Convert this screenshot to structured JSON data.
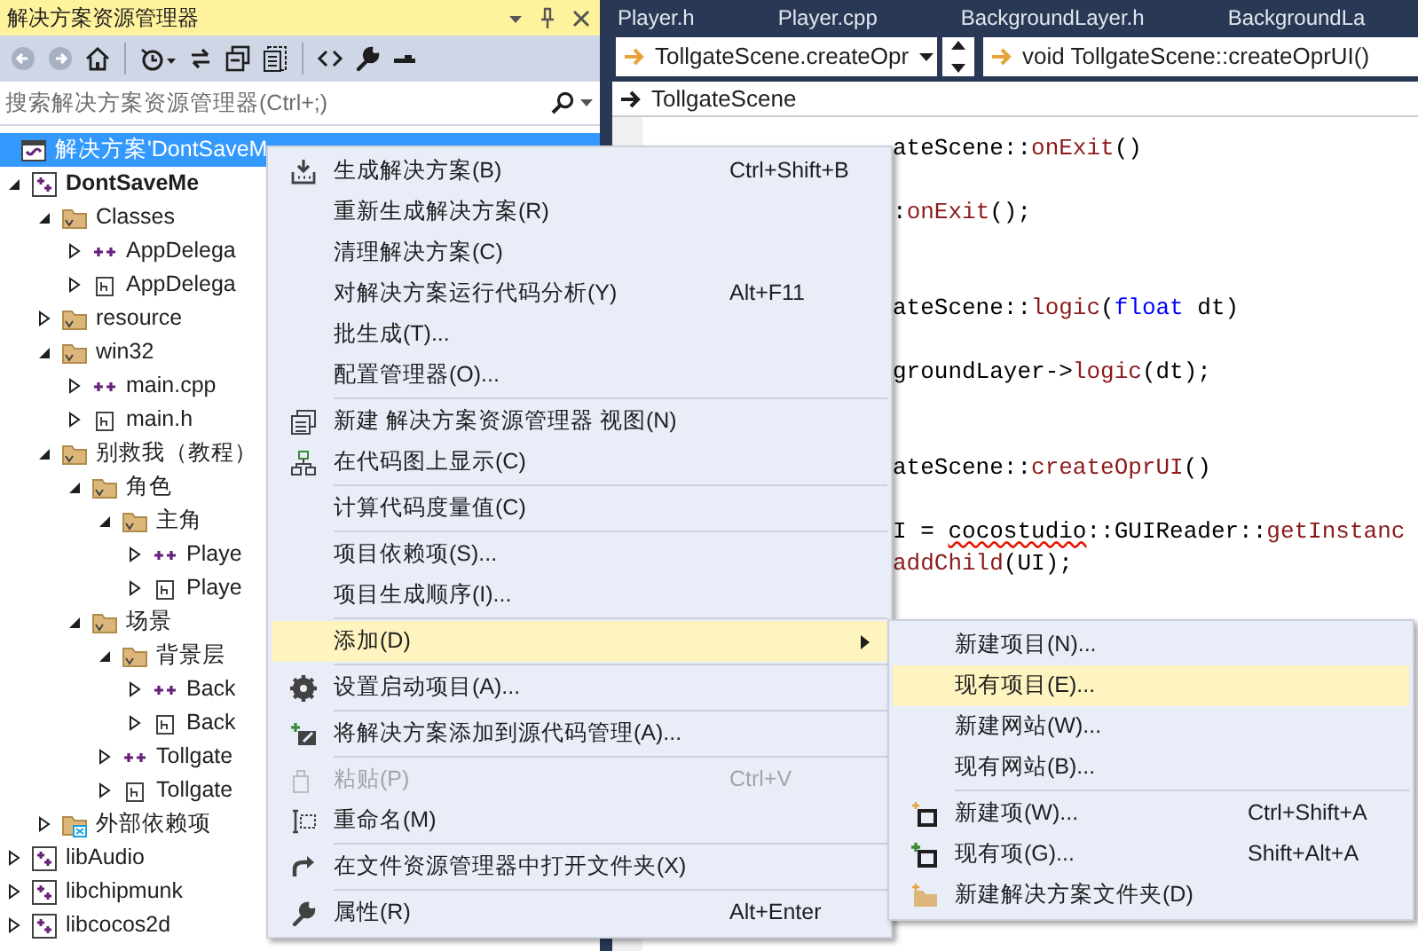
{
  "explorer": {
    "title": "解决方案资源管理器",
    "toolbar": [
      [
        {
          "kind": "back",
          "disabled": true
        },
        {
          "kind": "forward",
          "disabled": true
        },
        {
          "kind": "home",
          "disabled": false
        }
      ],
      [
        {
          "kind": "history",
          "disabled": false
        },
        {
          "kind": "sync",
          "disabled": false
        },
        {
          "kind": "collapse",
          "disabled": false
        },
        {
          "kind": "show_all",
          "disabled": false
        }
      ],
      [
        {
          "kind": "code",
          "disabled": false
        },
        {
          "kind": "wrench",
          "disabled": false
        },
        {
          "kind": "pending",
          "disabled": false
        }
      ]
    ],
    "search": {
      "placeholder": "搜索解决方案资源管理器(Ctrl+;)"
    },
    "tree": [
      {
        "label": "解决方案'DontSaveM",
        "kind": "solution",
        "selected": true
      },
      {
        "label": "DontSaveMe",
        "kind": "project",
        "startup": true,
        "expanded": true,
        "selected": false,
        "children": [
          {
            "label": "Classes",
            "kind": "filter",
            "expanded": true,
            "selected": false,
            "children": [
              {
                "label": "AppDelega",
                "kind": "cpp",
                "expanded": false,
                "selected": false
              },
              {
                "label": "AppDelega",
                "kind": "header",
                "expanded": false,
                "selected": false
              }
            ]
          },
          {
            "label": "resource",
            "kind": "filter",
            "expanded": false,
            "selected": false
          },
          {
            "label": "win32",
            "kind": "filter",
            "expanded": true,
            "selected": false,
            "children": [
              {
                "label": "main.cpp",
                "kind": "cpp",
                "expanded": false,
                "selected": false
              },
              {
                "label": "main.h",
                "kind": "header",
                "expanded": false,
                "selected": false
              }
            ]
          },
          {
            "label": "别救我（教程）",
            "kind": "filter",
            "expanded": true,
            "selected": false,
            "children": [
              {
                "label": "角色",
                "kind": "filter",
                "expanded": true,
                "selected": false,
                "children": [
                  {
                    "label": "主角",
                    "kind": "filter",
                    "expanded": true,
                    "selected": false,
                    "children": [
                      {
                        "label": "Playe",
                        "kind": "cpp",
                        "expanded": false,
                        "selected": false
                      },
                      {
                        "label": "Playe",
                        "kind": "header",
                        "expanded": false,
                        "selected": false
                      }
                    ]
                  }
                ]
              },
              {
                "label": "场景",
                "kind": "filter",
                "expanded": true,
                "selected": false,
                "children": [
                  {
                    "label": "背景层",
                    "kind": "filter",
                    "expanded": true,
                    "selected": false,
                    "children": [
                      {
                        "label": "Back",
                        "kind": "cpp",
                        "expanded": false,
                        "selected": false
                      },
                      {
                        "label": "Back",
                        "kind": "header",
                        "expanded": false,
                        "selected": false
                      }
                    ]
                  },
                  {
                    "label": "Tollgate",
                    "kind": "cpp",
                    "expanded": false,
                    "selected": false
                  },
                  {
                    "label": "Tollgate",
                    "kind": "header",
                    "expanded": false,
                    "selected": false
                  }
                ]
              }
            ]
          },
          {
            "label": "外部依赖项",
            "kind": "external",
            "expanded": false,
            "selected": false
          }
        ]
      },
      {
        "label": "libAudio",
        "kind": "project",
        "expanded": false,
        "selected": false
      },
      {
        "label": "libchipmunk",
        "kind": "project",
        "expanded": false,
        "selected": false
      },
      {
        "label": "libcocos2d",
        "kind": "project",
        "expanded": false,
        "selected": false
      }
    ]
  },
  "editor": {
    "tabs": [
      {
        "label": "Player.h",
        "selected": false
      },
      {
        "label": "Player.cpp",
        "selected": false
      },
      {
        "label": "BackgroundLayer.h",
        "selected": false
      },
      {
        "label": "BackgroundLa",
        "selected": false
      }
    ],
    "class_combo": "TollgateScene.createOpr",
    "member_combo": "void TollgateScene::createOprUI()",
    "scope": "TollgateScene",
    "code_lines": [
      {
        "tokens": [
          {
            "text": "ateScene::",
            "kind": "plain"
          },
          {
            "text": "onExit",
            "kind": "func"
          },
          {
            "text": "()",
            "kind": "plain"
          }
        ]
      },
      {
        "tokens": [
          {
            "text": ":",
            "kind": "plain"
          },
          {
            "text": "onExit",
            "kind": "func"
          },
          {
            "text": "();",
            "kind": "plain"
          }
        ]
      },
      {
        "tokens": [
          {
            "text": "ateScene::",
            "kind": "plain"
          },
          {
            "text": "logic",
            "kind": "func"
          },
          {
            "text": "(",
            "kind": "plain"
          },
          {
            "text": "float",
            "kind": "keyword"
          },
          {
            "text": " dt)",
            "kind": "plain"
          }
        ]
      },
      {
        "tokens": [
          {
            "text": "groundLayer->",
            "kind": "plain"
          },
          {
            "text": "logic",
            "kind": "func"
          },
          {
            "text": "(dt);",
            "kind": "plain"
          }
        ]
      },
      {
        "tokens": [
          {
            "text": "ateScene::",
            "kind": "plain"
          },
          {
            "text": "createOprUI",
            "kind": "func"
          },
          {
            "text": "()",
            "kind": "plain"
          }
        ]
      },
      {
        "tokens": [
          {
            "text": "I = ",
            "kind": "plain"
          },
          {
            "text": "cocostudio",
            "kind": "error"
          },
          {
            "text": "::GUIReader::",
            "kind": "plain"
          },
          {
            "text": "getInstanc",
            "kind": "func"
          }
        ]
      },
      {
        "tokens": [
          {
            "text": "addChild",
            "kind": "func"
          },
          {
            "text": "(UI);",
            "kind": "plain"
          }
        ]
      }
    ]
  },
  "context_menu": {
    "groups": [
      {
        "items": [
          {
            "label": "生成解决方案(B)",
            "kind": "build",
            "shortcut": "Ctrl+Shift+B",
            "selected": false,
            "disabled": false
          },
          {
            "label": "重新生成解决方案(R)",
            "selected": false,
            "disabled": false
          },
          {
            "label": "清理解决方案(C)",
            "selected": false,
            "disabled": false
          },
          {
            "label": "对解决方案运行代码分析(Y)",
            "shortcut": "Alt+F11",
            "selected": false,
            "disabled": false
          },
          {
            "label": "批生成(T)...",
            "selected": false,
            "disabled": false
          },
          {
            "label": "配置管理器(O)...",
            "selected": false,
            "disabled": false
          }
        ]
      },
      {
        "items": [
          {
            "label": "新建 解决方案资源管理器 视图(N)",
            "kind": "new_view",
            "selected": false,
            "disabled": false
          },
          {
            "label": "在代码图上显示(C)",
            "kind": "code_map",
            "selected": false,
            "disabled": false
          }
        ]
      },
      {
        "items": [
          {
            "label": "计算代码度量值(C)",
            "selected": false,
            "disabled": false
          }
        ]
      },
      {
        "items": [
          {
            "label": "项目依赖项(S)...",
            "selected": false,
            "disabled": false
          },
          {
            "label": "项目生成顺序(I)...",
            "selected": false,
            "disabled": false
          }
        ]
      },
      {
        "items": [
          {
            "label": "添加(D)",
            "submenu": true,
            "selected": true,
            "disabled": false
          }
        ]
      },
      {
        "items": [
          {
            "label": "设置启动项目(A)...",
            "kind": "gear",
            "selected": false,
            "disabled": false
          }
        ]
      },
      {
        "items": [
          {
            "label": "将解决方案添加到源代码管理(A)...",
            "kind": "source_control",
            "selected": false,
            "disabled": false
          }
        ]
      },
      {
        "items": [
          {
            "label": "粘贴(P)",
            "kind": "paste",
            "shortcut": "Ctrl+V",
            "selected": false,
            "disabled": true
          },
          {
            "label": "重命名(M)",
            "kind": "rename",
            "selected": false,
            "disabled": false
          }
        ]
      },
      {
        "items": [
          {
            "label": "在文件资源管理器中打开文件夹(X)",
            "kind": "open_folder",
            "selected": false,
            "disabled": false
          }
        ]
      },
      {
        "items": [
          {
            "label": "属性(R)",
            "kind": "wrench",
            "shortcut": "Alt+Enter",
            "selected": false,
            "disabled": false
          }
        ]
      }
    ]
  },
  "submenu": {
    "groups": [
      {
        "items": [
          {
            "label": "新建项目(N)...",
            "selected": false
          },
          {
            "label": "现有项目(E)...",
            "selected": true
          },
          {
            "label": "新建网站(W)...",
            "selected": false
          },
          {
            "label": "现有网站(B)...",
            "selected": false
          }
        ]
      },
      {
        "items": [
          {
            "label": "新建项(W)...",
            "kind": "new_item",
            "shortcut": "Ctrl+Shift+A",
            "selected": false
          },
          {
            "label": "现有项(G)...",
            "kind": "add_item",
            "shortcut": "Shift+Alt+A",
            "selected": false
          },
          {
            "label": "新建解决方案文件夹(D)",
            "kind": "new_folder",
            "selected": false
          }
        ]
      }
    ]
  }
}
